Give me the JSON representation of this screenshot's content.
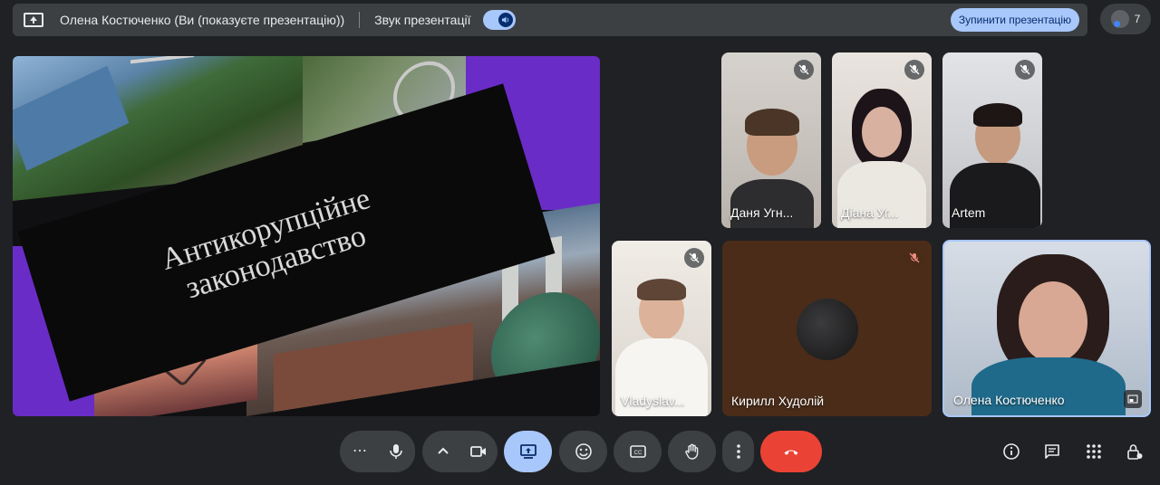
{
  "top_bar": {
    "presenter_text": "Олена Костюченко (Ви (показуєте презентацію))",
    "audio_label": "Звук презентації",
    "stop_button_label": "Зупинити презентацію",
    "participant_count": "7"
  },
  "slide": {
    "title": "Антикорупційне законодавство"
  },
  "participants": [
    {
      "name": "Даня Угн...",
      "muted": true
    },
    {
      "name": "Діана Уг...",
      "muted": true
    },
    {
      "name": "Artem",
      "muted": true
    },
    {
      "name": "Vladyslav...",
      "muted": true
    },
    {
      "name": "Кирилл Худолій",
      "muted": true
    },
    {
      "name": "Олена Костюченко",
      "muted": false
    }
  ],
  "controls": {
    "more_options_left": "⋯",
    "buttons": [
      "more-options",
      "microphone",
      "camera-options",
      "camera",
      "present",
      "reactions",
      "captions",
      "raise-hand",
      "more-actions",
      "leave-call"
    ],
    "right_icons": [
      "info",
      "chat",
      "activities",
      "host-controls"
    ]
  },
  "colors": {
    "background": "#202124",
    "accent": "#a8c7fa",
    "leave_red": "#ea4335",
    "slide_purple": "#6a2cc6"
  }
}
